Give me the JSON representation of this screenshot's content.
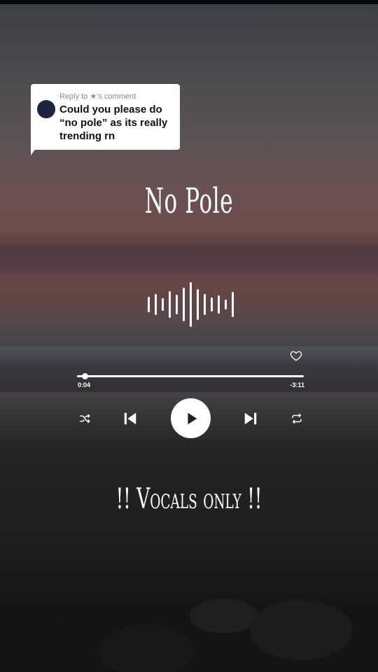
{
  "reply": {
    "header": "Reply to ★'s comment",
    "text": "Could you please do “no pole” as its really trending rn"
  },
  "player": {
    "title": "No Pole",
    "elapsed": "0:04",
    "remaining": "-3:11",
    "progress_fraction": 0.035,
    "liked": false
  },
  "caption": "!! Vocals only !!",
  "icons": {
    "like": "heart-icon",
    "shuffle": "shuffle-icon",
    "previous": "skip-previous-icon",
    "play": "play-icon",
    "next": "skip-next-icon",
    "repeat": "repeat-icon"
  },
  "colors": {
    "bubble": "#ffffff",
    "avatar": "#1c2340",
    "controls": "#ffffff"
  }
}
